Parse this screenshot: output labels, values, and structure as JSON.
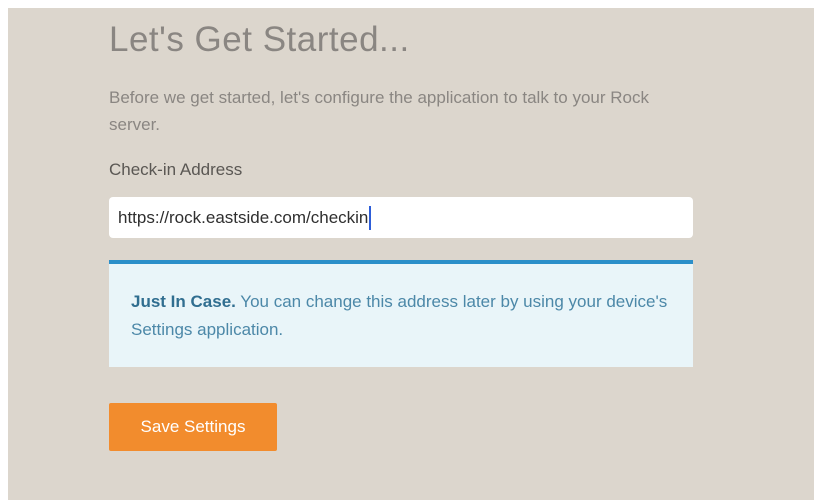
{
  "setup": {
    "title": "Let's Get Started...",
    "intro": "Before we get started, let's configure the application to talk to your Rock server."
  },
  "form": {
    "address_label": "Check-in Address",
    "address_value": "https://rock.eastside.com/checkin"
  },
  "info": {
    "heading": "Just In Case.",
    "text": " You can change this address later by using your device's Settings application."
  },
  "actions": {
    "save_label": "Save Settings"
  },
  "colors": {
    "background": "#dcd6cd",
    "accent_orange": "#f28c2d",
    "info_border": "#2b8fc9",
    "info_background": "#e9f5f9"
  }
}
